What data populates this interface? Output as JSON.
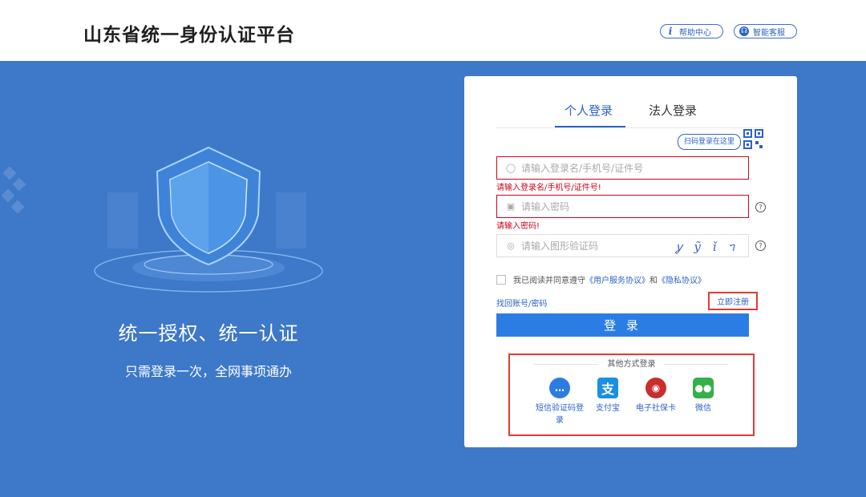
{
  "header": {
    "site_title": "山东省统一身份认证平台",
    "help_label": "帮助中心",
    "service_label": "智能客服"
  },
  "hero": {
    "slogan_main": "统一授权、统一认证",
    "slogan_sub": "只需登录一次，全网事项通办"
  },
  "login": {
    "tabs": [
      {
        "label": "个人登录",
        "active": true
      },
      {
        "label": "法人登录",
        "active": false
      }
    ],
    "qr_hint": "扫码登录在这里",
    "username_placeholder": "请输入登录名/手机号/证件号",
    "username_error": "请输入登录名/手机号/证件号!",
    "password_placeholder": "请输入密码",
    "password_error": "请输入密码!",
    "captcha_placeholder": "请输入图形验证码",
    "captcha_text": "ỿ ỹ ǐ ᥐ",
    "agree_prefix": "我已阅读并同意遵守",
    "agree_link1": "《用户服务协议》",
    "agree_and": "和",
    "agree_link2": "《隐私协议》",
    "forgot_label": "找回账号/密码",
    "register_label": "立即注册",
    "submit_label": "登 录"
  },
  "other_methods": {
    "title": "其他方式登录",
    "options": [
      {
        "label": "短信验证码登录",
        "icon": "sms-icon"
      },
      {
        "label": "支付宝",
        "icon": "alipay-icon"
      },
      {
        "label": "电子社保卡",
        "icon": "social-card-icon"
      },
      {
        "label": "微信",
        "icon": "wechat-icon"
      }
    ]
  },
  "colors": {
    "brand_blue": "#2c62c8",
    "background": "#3d78c9",
    "error_red": "#d0021b",
    "highlight_red": "#e53935"
  }
}
